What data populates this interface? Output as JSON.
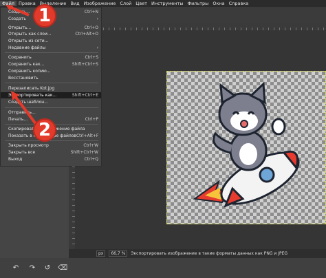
{
  "menubar": {
    "items": [
      "Файл",
      "Правка",
      "Выделение",
      "Вид",
      "Изображение",
      "Слой",
      "Цвет",
      "Инструменты",
      "Фильтры",
      "Окна",
      "Справка"
    ]
  },
  "file_menu": {
    "items": [
      {
        "label": "Создать...",
        "shortcut": "Ctrl+N"
      },
      {
        "label": "Создать",
        "shortcut": "›"
      },
      {
        "label": "Открыть...",
        "shortcut": "Ctrl+O"
      },
      {
        "label": "Открыть как слои...",
        "shortcut": "Ctrl+Alt+O"
      },
      {
        "label": "Открыть из сети...",
        "shortcut": ""
      },
      {
        "label": "Недавние файлы",
        "shortcut": "›"
      },
      {
        "label": "Сохранить",
        "shortcut": "Ctrl+S"
      },
      {
        "label": "Сохранить как...",
        "shortcut": "Shift+Ctrl+S"
      },
      {
        "label": "Сохранить копию...",
        "shortcut": ""
      },
      {
        "label": "Восстановить",
        "shortcut": ""
      },
      {
        "label": "Перезаписать Kot.jpg",
        "shortcut": ""
      },
      {
        "label": "Экспортировать как...",
        "shortcut": "Shift+Ctrl+E"
      },
      {
        "label": "Создать шаблон...",
        "shortcut": ""
      },
      {
        "label": "Отправить...",
        "shortcut": ""
      },
      {
        "label": "Печать...",
        "shortcut": "Ctrl+P"
      },
      {
        "label": "Скопировать расположение файла",
        "shortcut": ""
      },
      {
        "label": "Показать в менеджере файлов",
        "shortcut": "Ctrl+Alt+F"
      },
      {
        "label": "Закрыть просмотр",
        "shortcut": "Ctrl+W"
      },
      {
        "label": "Закрыть все",
        "shortcut": "Shift+Ctrl+W"
      },
      {
        "label": "Выход",
        "shortcut": "Ctrl+Q"
      }
    ]
  },
  "annotations": {
    "marker1": "1",
    "marker2": "2"
  },
  "statusbar": {
    "unit": "px",
    "zoom": "66,7 %",
    "message": "Экспортировать изображение в такие форматы данных как PNG и JPEG"
  },
  "colors": {
    "marker": "#e23a2b",
    "highlight": "#1e1e1e",
    "selection_border": "#d8d84a"
  },
  "icons": [
    "cat-rocket-image",
    "undo-icon",
    "redo-icon",
    "reset-icon",
    "delete-icon"
  ]
}
